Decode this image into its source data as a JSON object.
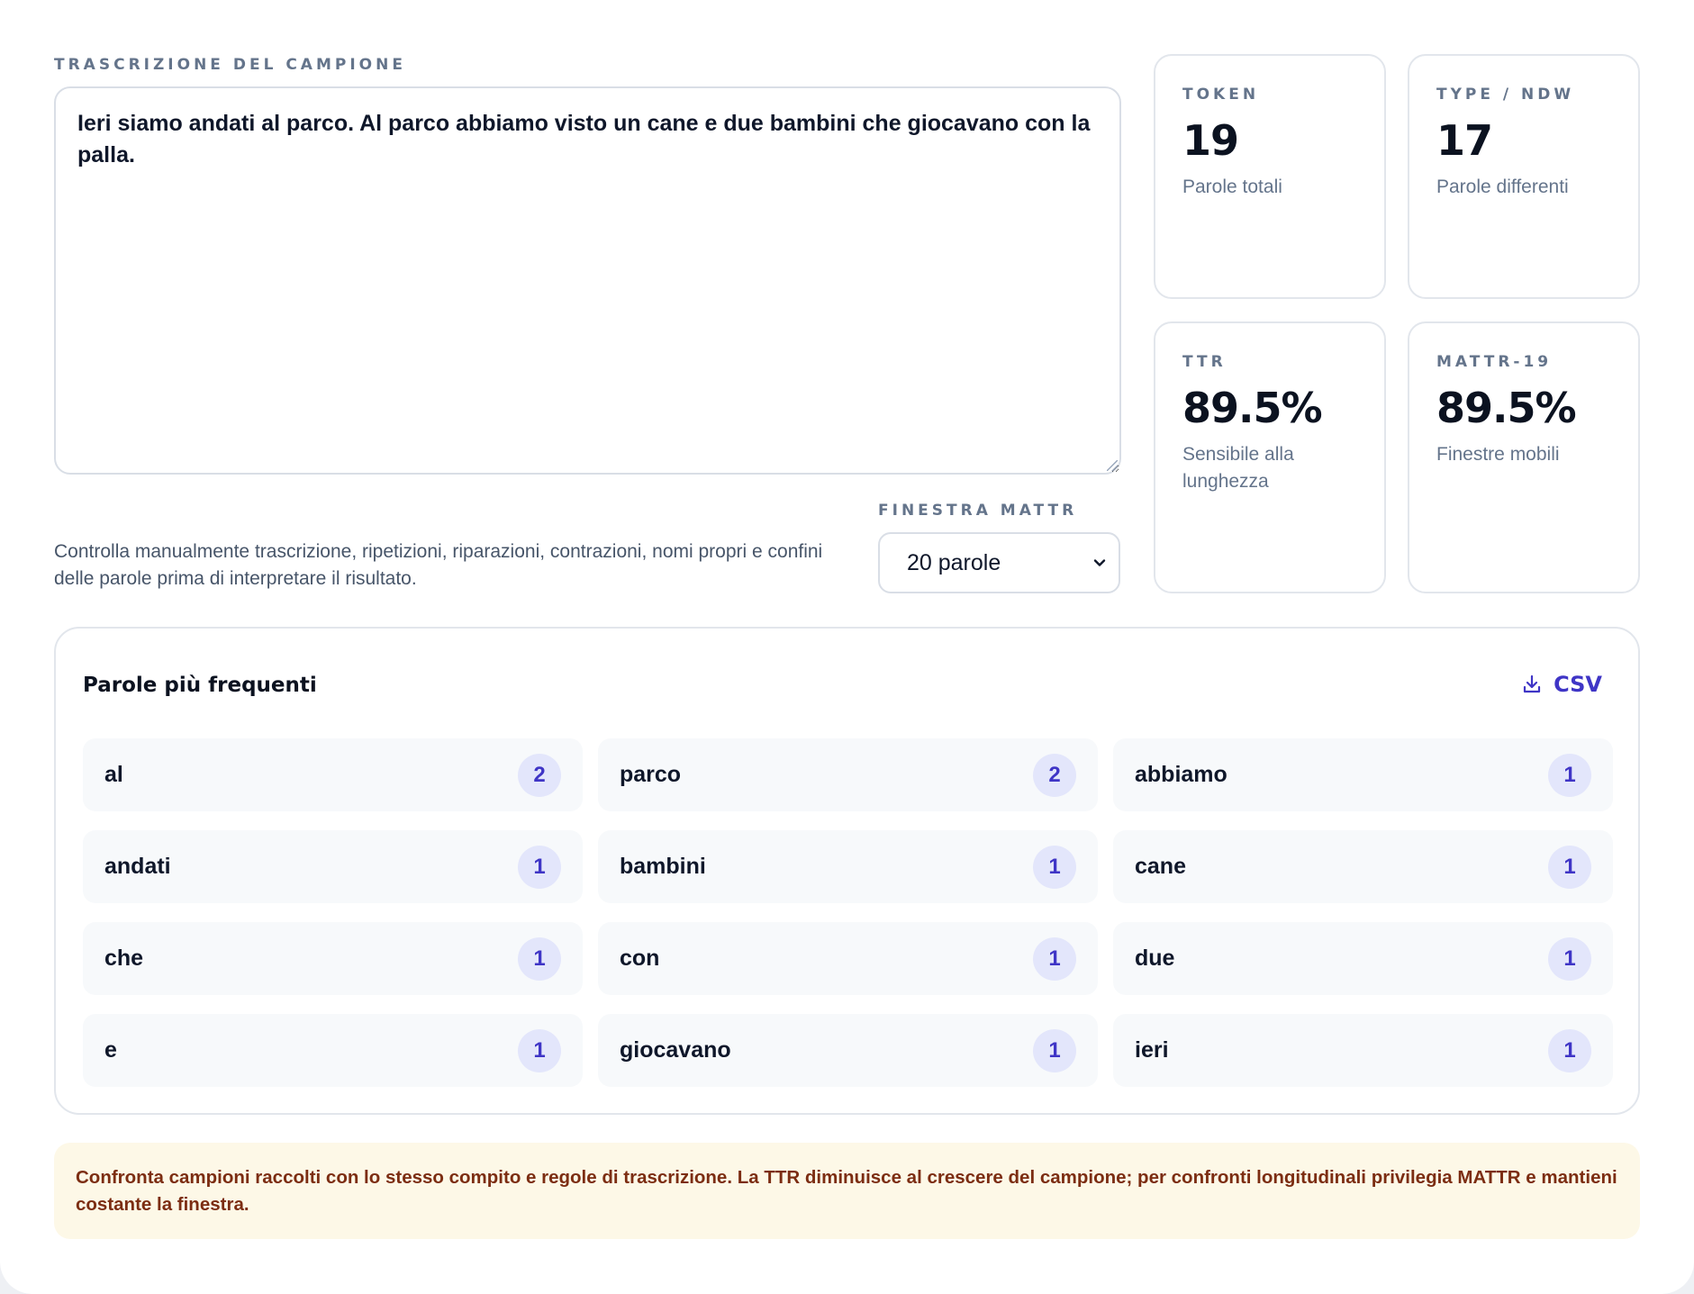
{
  "transcript": {
    "label": "TRASCRIZIONE DEL CAMPIONE",
    "value": "Ieri siamo andati al parco. Al parco abbiamo visto un cane e due bambini che giocavano con la palla."
  },
  "note": "Controlla manualmente trascrizione, ripetizioni, riparazioni, contrazioni, nomi propri e confini delle parole prima di interpretare il risultato.",
  "mattr_window": {
    "label": "FINESTRA MATTR",
    "selected": "20 parole"
  },
  "stats": {
    "token": {
      "label": "TOKEN",
      "value": "19",
      "caption": "Parole totali"
    },
    "type": {
      "label": "TYPE / NDW",
      "value": "17",
      "caption": "Parole differenti"
    },
    "ttr": {
      "label": "TTR",
      "value": "89.5%",
      "caption": "Sensibile alla lunghezza"
    },
    "mattr": {
      "label": "MATTR-19",
      "value": "89.5%",
      "caption": "Finestre mobili"
    }
  },
  "frequent": {
    "title": "Parole più frequenti",
    "csv_label": "CSV",
    "items": [
      {
        "word": "al",
        "count": "2"
      },
      {
        "word": "parco",
        "count": "2"
      },
      {
        "word": "abbiamo",
        "count": "1"
      },
      {
        "word": "andati",
        "count": "1"
      },
      {
        "word": "bambini",
        "count": "1"
      },
      {
        "word": "cane",
        "count": "1"
      },
      {
        "word": "che",
        "count": "1"
      },
      {
        "word": "con",
        "count": "1"
      },
      {
        "word": "due",
        "count": "1"
      },
      {
        "word": "e",
        "count": "1"
      },
      {
        "word": "giocavano",
        "count": "1"
      },
      {
        "word": "ieri",
        "count": "1"
      }
    ]
  },
  "footer_note": "Confronta campioni raccolti con lo stesso compito e regole di trascrizione. La TTR diminuisce al crescere del campione; per confronti longitudinali privilegia MATTR e mantieni costante la finestra."
}
